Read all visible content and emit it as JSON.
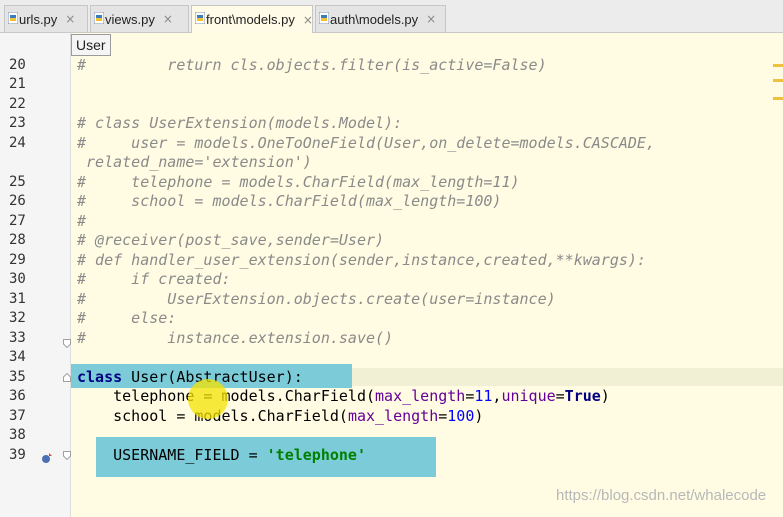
{
  "tabs": [
    {
      "name": "urls.py",
      "active": false
    },
    {
      "name": "views.py",
      "active": false
    },
    {
      "name": "front\\models.py",
      "active": true
    },
    {
      "name": "auth\\models.py",
      "active": false
    }
  ],
  "close_glyph": "×",
  "tooltip": "User",
  "line_numbers": [
    "20",
    "21",
    "22",
    "23",
    "24",
    "",
    "25",
    "26",
    "27",
    "28",
    "29",
    "30",
    "31",
    "32",
    "33",
    "34",
    "35",
    "36",
    "37",
    "38",
    "39"
  ],
  "code": {
    "l20": "#         return cls.objects.filter(is_active=False)",
    "l23": "# class UserExtension(models.Model):",
    "l24a": "#     user = models.OneToOneField(User,on_delete=models.CASCADE,",
    "l24b": " related_name='extension')",
    "l25": "#     telephone = models.CharField(max_length=11)",
    "l26": "#     school = models.CharField(max_length=100)",
    "l27": "#",
    "l28": "# @receiver(post_save,sender=User)",
    "l29": "# def handler_user_extension(sender,instance,created,**kwargs):",
    "l30": "#     if created:",
    "l31": "#         UserExtension.objects.create(user=instance)",
    "l32": "#     else:",
    "l33": "#         instance.extension.save()",
    "l35": {
      "kw": "class",
      "name": " User(AbstractUser):"
    },
    "l36": {
      "a": "    telephone = models.CharField(",
      "k1": "max_length",
      "eq1": "=",
      "n1": "11",
      "comma": ",",
      "k2": "unique",
      "eq2": "=",
      "t": "True",
      "close": ")"
    },
    "l37": {
      "a": "    school = models.CharField(",
      "k1": "max_length",
      "eq1": "=",
      "n1": "100",
      "close": ")"
    },
    "l39": {
      "a": "    USERNAME_FIELD = ",
      "s": "'telephone'"
    }
  },
  "watermark": "https://blog.csdn.net/whalecode",
  "colors": {
    "highlight": "#5ec1d6",
    "cursor": "#f4e300",
    "editor_bg": "#fffce3"
  }
}
